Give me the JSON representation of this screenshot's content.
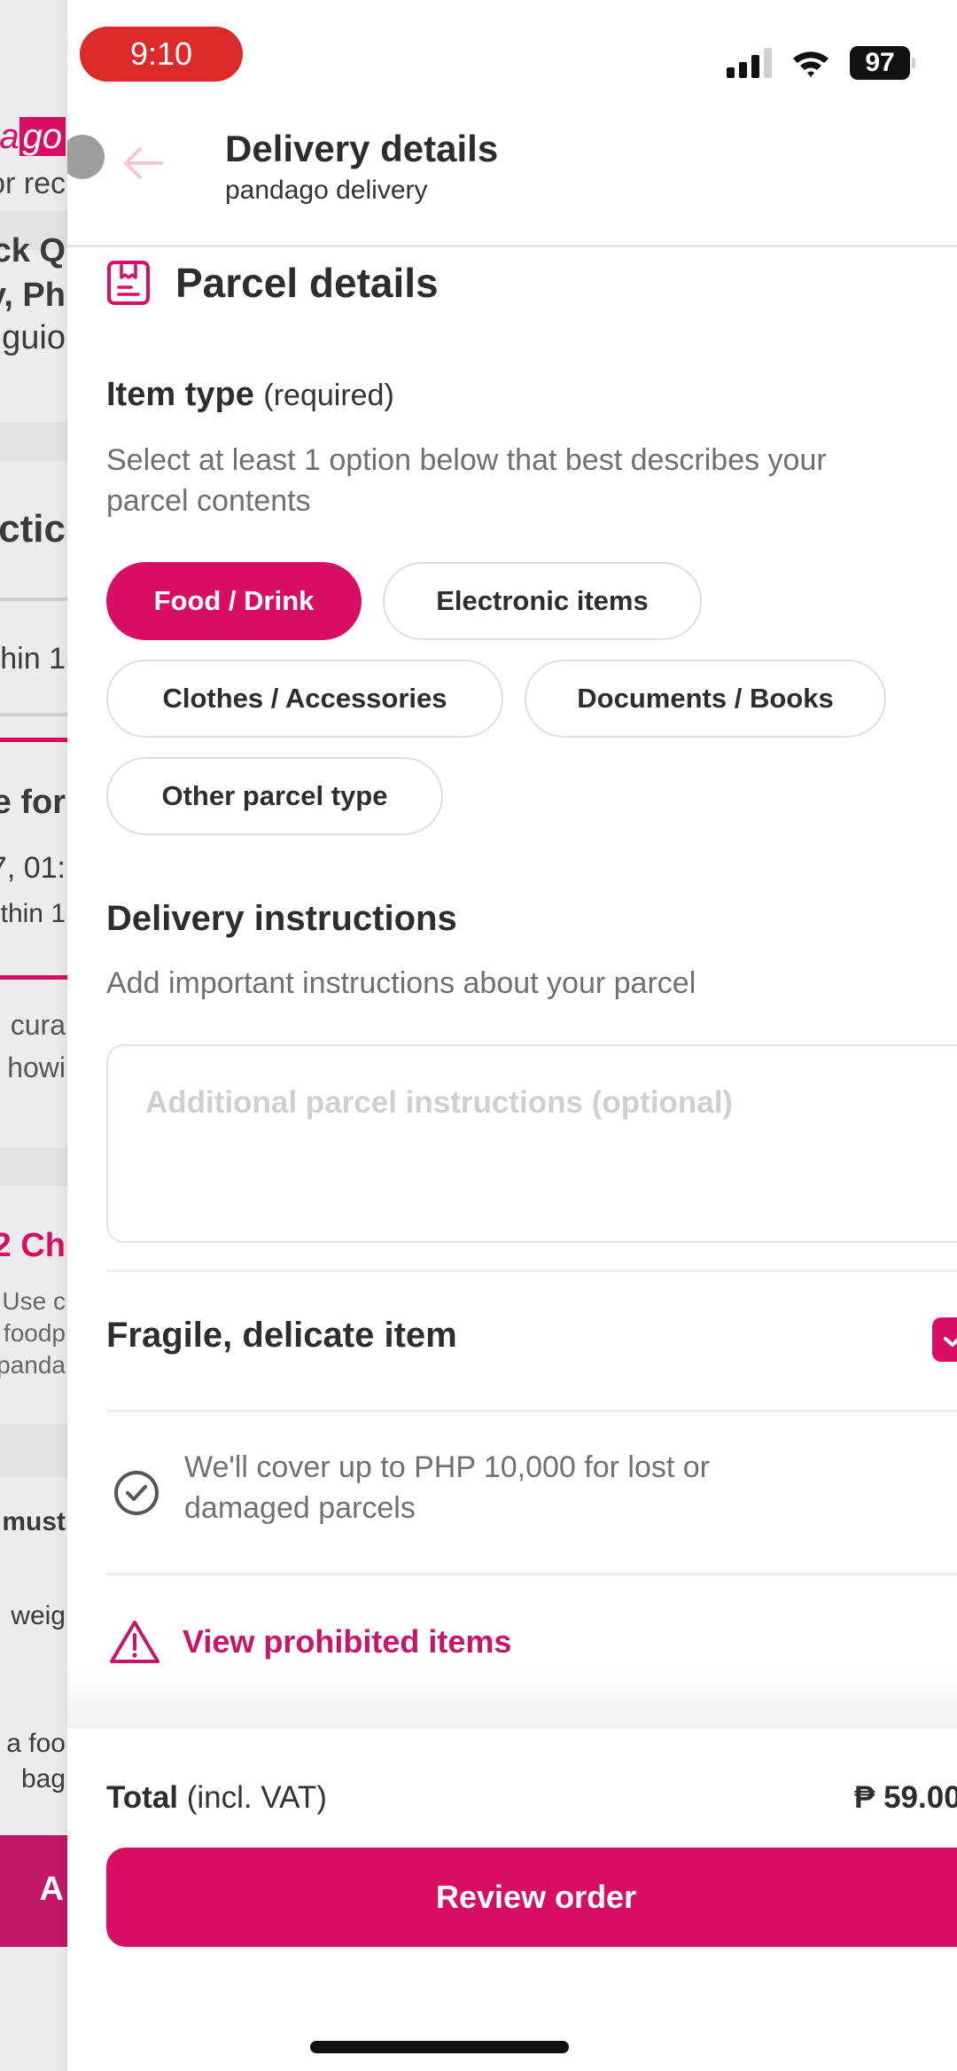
{
  "status_bar": {
    "time": "9:10",
    "battery_level": "97",
    "signal_bars_active": 3,
    "signal_bars_total": 4
  },
  "background_screen": {
    "brand_prefix": "a",
    "brand_suffix": "go",
    "fragments": [
      "or rec",
      "ck Q",
      "y, Ph",
      "guio",
      "ctic",
      "hin 1",
      "e for",
      "7, 01:",
      "thin 1",
      "cura",
      "howi",
      "2 Ch",
      "Use c",
      "foodp",
      "panda",
      "must",
      "weig",
      "a foo",
      "bag",
      "A"
    ]
  },
  "header": {
    "title": "Delivery details",
    "subtitle": "pandago delivery",
    "back_icon": "arrow-left-icon"
  },
  "parcel": {
    "section_title": "Parcel details",
    "section_icon": "parcel-box-icon",
    "item_type_label": "Item type",
    "item_type_required": "(required)",
    "item_type_helper_line1": "Select at least 1 option below that best describes your",
    "item_type_helper_line2": "parcel contents",
    "item_types": [
      {
        "label": "Food / Drink",
        "selected": true
      },
      {
        "label": "Electronic items",
        "selected": false
      },
      {
        "label": "Clothes / Accessories",
        "selected": false
      },
      {
        "label": "Documents / Books",
        "selected": false
      },
      {
        "label": "Other parcel type",
        "selected": false
      }
    ],
    "instructions_title": "Delivery instructions",
    "instructions_helper": "Add important instructions about your parcel",
    "instructions_value": "",
    "instructions_placeholder": "Additional parcel instructions (optional)",
    "fragile_label": "Fragile, delicate item",
    "fragile_checked": true,
    "coverage_text_line1": "We'll cover up to PHP 10,000 for lost or",
    "coverage_text_line2": "damaged parcels",
    "coverage_icon": "check-circle-icon",
    "prohibited_link": "View prohibited items",
    "prohibited_icon": "warning-triangle-icon"
  },
  "footer": {
    "total_label": "Total",
    "total_suffix": "(incl. VAT)",
    "total_amount": "₱ 59.00",
    "review_button": "Review order"
  },
  "colors": {
    "brand": "#d70f64",
    "text_primary": "#2d2d2d",
    "text_secondary": "#6f6f73",
    "status_time_pill": "#dc2a2a"
  }
}
